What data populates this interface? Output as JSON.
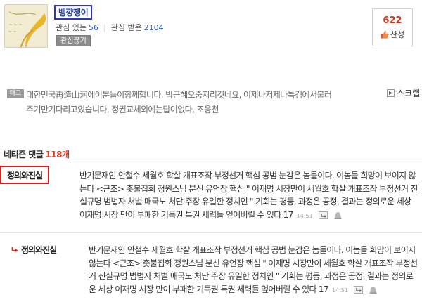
{
  "profile": {
    "nickname": "뱅꺙쟁이",
    "interest_label": "관심 있는",
    "interest_count": "56",
    "interested_label": "관심 받은",
    "interested_count": "2104",
    "unfollow_button": "관심끊기"
  },
  "vote": {
    "count": "622",
    "label": "찬성"
  },
  "tags": {
    "badge": "태그",
    "line1": "대한민국再造山河에이분들이함께합니다, 박근혜오줌지리것네요, 이제나저제나특검에서불러",
    "line2": "주기만기다리고있습니다, 정권교체외에는답이없다, 조응천",
    "scrap_label": "스크랩"
  },
  "comments_header": {
    "label": "네티즌 댓글",
    "count": "118개"
  },
  "comments": [
    {
      "author": "정의와진실",
      "text": "반기문재인 안철수 세월호 학살 개표조작 부정선거 핵심 공범 눈감은 놈들이다. 이놈들 희망이 보이지 않는다 <근조> 촛불집회 정원스님 분신 유언장 핵심 \" 이재명 시장만이 세월호 학살 개표조작 부정선거 진실규명 범법자 처벌 매국노 처단 주장 유일한 정치인 \" 기회는 평등, 과정은 공정, 결과는 정의로운 세상 이재명 시장 만이 부패한 기득권 특권 세력들 엎어버릴 수 있다 17",
      "time": "14:51"
    },
    {
      "author": "정의와진실",
      "text": "반기문재인 안철수 세월호 학살 개표조작 부정선거 핵심 공범 눈감은 놈들이다. 이놈들 희망이 보이지 않는다 <근조> 촛불집회 정원스님 분신 유언장 핵심 \" 이재명 시장만이 세월호 학살 개표조작 부정선거 진실규명 범법자 처벌 매국노 처단 주장 유일한 정치인 \" 기회는 평등, 과정은 공정, 결과는 정의로운 세상 이재명 시장 만이 부패한 기득권 특권 세력들 엎어버릴 수 있다 17",
      "time": "14:51"
    }
  ],
  "colors": {
    "accent_red": "#d5361e",
    "link_blue": "#2f58b6",
    "highlight_blue_box": "#2b35c8",
    "highlight_red_box": "#de1b1b"
  },
  "icons": [
    "avatar-image",
    "thumbs-up-icon",
    "scrap-icon",
    "reply-arrow-icon",
    "reply-button-icon",
    "report-icon"
  ]
}
